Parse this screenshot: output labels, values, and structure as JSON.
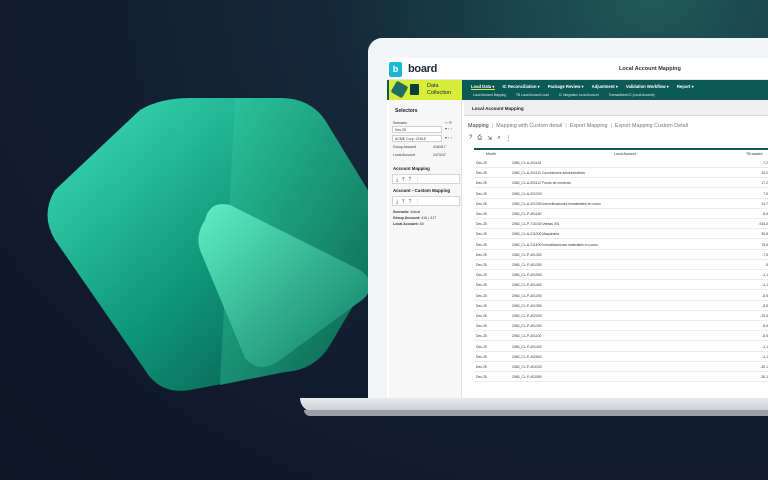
{
  "app": {
    "brand": "board",
    "title": "Local Account Mapping",
    "logo_letter": "b"
  },
  "data_collection": {
    "label": "Data Collection"
  },
  "nav": {
    "items": [
      {
        "label": "Load Data ▾",
        "active": true
      },
      {
        "label": "IC Reconciliation ▾",
        "active": false
      },
      {
        "label": "Package Review ▾",
        "active": false
      },
      {
        "label": "Adjustment ▾",
        "active": false
      },
      {
        "label": "Validation Workflow ▾",
        "active": false
      },
      {
        "label": "Report ▾",
        "active": false
      }
    ],
    "sub_items": [
      {
        "label": "Local Account Mapping"
      },
      {
        "label": "TB Local Account Load"
      },
      {
        "label": "IC Integration Local Account"
      },
      {
        "label": "Transactional IC (Local Account)"
      }
    ]
  },
  "selectors": {
    "title": "Selectors",
    "scenario_label": "Scenario",
    "scenario_value": "Dec.25",
    "entity_value": "ACME Corp, CHILE",
    "group_account_label": "Group Account",
    "group_account_value": "416/417",
    "local_account_label": "Local Account",
    "local_account_value": "247/247"
  },
  "account_mapping": {
    "title": "Account Mapping",
    "custom_title": "Account - Custom Mapping"
  },
  "info": {
    "scenario_label": "Scenario:",
    "scenario_value": "Actual",
    "group_label": "Group Account:",
    "group_value": "416 / 417",
    "local_label": "Local Account:",
    "local_value": "All"
  },
  "content": {
    "title": "Local Account Mapping",
    "tabs": [
      {
        "label": "Mapping",
        "active": true
      },
      {
        "label": "Mapping with Custom detail",
        "active": false
      },
      {
        "label": "Export Mapping",
        "active": false
      },
      {
        "label": "Export Mapping Custom Detail",
        "active": false
      }
    ],
    "table": {
      "headers": {
        "month": "Month",
        "local": "Local Account",
        "tb": "TB loaded"
      },
      "rows": [
        {
          "month": "Dec.25",
          "account": "2060_CL-A-201110",
          "value": "7,2"
        },
        {
          "month": "Dec.25",
          "account": "2060_CL-A-201111 Concesiones administrativas",
          "value": "25,0"
        },
        {
          "month": "Dec.25",
          "account": "2060_CL-A-201112 Fondo de comercio",
          "value": "17,2"
        },
        {
          "month": "Dec.25",
          "account": "2060_CL-A-201200",
          "value": "7,5"
        },
        {
          "month": "Dec.25",
          "account": "2060_CL-A-201250 Inmovilizaciones inmateriales en curso",
          "value": "14,7"
        },
        {
          "month": "Dec.25",
          "account": "2060_CL-P-401150",
          "value": "-8,5"
        },
        {
          "month": "Dec.25",
          "account": "2060_CL-P-710100 Ventas 001",
          "value": "-915,6"
        },
        {
          "month": "Dec.25",
          "account": "2060_CL-A-211000 Maquinaria",
          "value": "95,8"
        },
        {
          "month": "Dec.25",
          "account": "2060_CL-A-211400 Inmovilizaciones materiales en curso",
          "value": "75,6"
        },
        {
          "month": "Dec.25",
          "account": "2060_CL-P-401300",
          "value": "-7,5"
        },
        {
          "month": "Dec.25",
          "account": "2060_CL-P-401350",
          "value": "8"
        },
        {
          "month": "Dec.25",
          "account": "2060_CL-P-401500",
          "value": "-1,1"
        },
        {
          "month": "Dec.25",
          "account": "2060_CL-P-401450",
          "value": "-1,1"
        },
        {
          "month": "Dec.25",
          "account": "2060_CL-P-401250",
          "value": "-8,5"
        },
        {
          "month": "Dec.25",
          "account": "2060_CL-P-401350",
          "value": "-8,5"
        },
        {
          "month": "Dec.25",
          "account": "2060_CL-P-402000",
          "value": "-25,5"
        },
        {
          "month": "Dec.25",
          "account": "2060_CL-P-401250",
          "value": "-8,5"
        },
        {
          "month": "Dec.25",
          "account": "2060_CL-P-401100",
          "value": "-8,5"
        },
        {
          "month": "Dec.25",
          "account": "2060_CL-P-401400",
          "value": "-1,1"
        },
        {
          "month": "Dec.25",
          "account": "2060_CL-P-402500",
          "value": "-1,1"
        },
        {
          "month": "Dec.25",
          "account": "2060_CL-P-403100",
          "value": "-30,1"
        },
        {
          "month": "Dec.25",
          "account": "2060_CL-P-403050",
          "value": "-30,1"
        }
      ]
    }
  },
  "colors": {
    "accent": "#0c5a56",
    "lime": "#d8ec3c",
    "logo_teal": "#18b7d6"
  }
}
